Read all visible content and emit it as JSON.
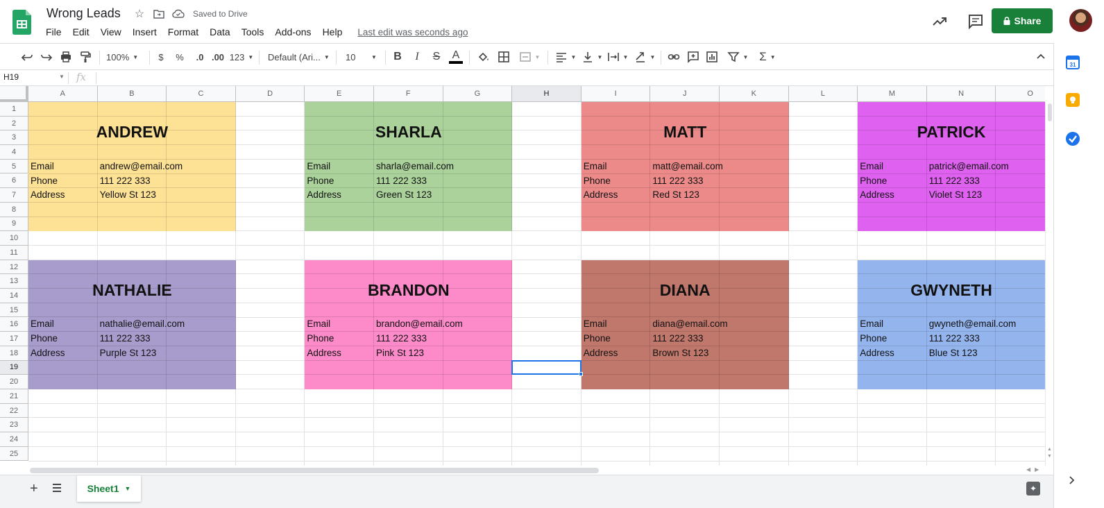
{
  "doc": {
    "title": "Wrong Leads",
    "saved_status": "Saved to Drive",
    "last_edit": "Last edit was seconds ago",
    "share_label": "Share"
  },
  "menu": [
    "File",
    "Edit",
    "View",
    "Insert",
    "Format",
    "Data",
    "Tools",
    "Add-ons",
    "Help"
  ],
  "toolbar": {
    "zoom": "100%",
    "currency": "$",
    "percent": "%",
    "decrease_decimal": ".0",
    "increase_decimal": ".00",
    "more_formats": "123",
    "font": "Default (Ari...",
    "font_size": "10"
  },
  "formula_bar": {
    "name_box": "H19",
    "fx_label": "fx",
    "content": ""
  },
  "columns": [
    "A",
    "B",
    "C",
    "D",
    "E",
    "F",
    "G",
    "H",
    "I",
    "J",
    "K",
    "L",
    "M",
    "N",
    "O"
  ],
  "rows": [
    "1",
    "2",
    "3",
    "4",
    "5",
    "6",
    "7",
    "8",
    "9",
    "10",
    "11",
    "12",
    "13",
    "14",
    "15",
    "16",
    "17",
    "18",
    "19",
    "20",
    "21",
    "22",
    "23",
    "24",
    "25"
  ],
  "selected_cell": "H19",
  "cards": [
    {
      "name": "ANDREW",
      "email": "andrew@email.com",
      "phone": "111 222 333",
      "address": "Yellow St 123",
      "color": "#fde195"
    },
    {
      "name": "SHARLA",
      "email": "sharla@email.com",
      "phone": "111 222 333",
      "address": "Green St 123",
      "color": "#acd29c"
    },
    {
      "name": "MATT",
      "email": "matt@email.com",
      "phone": "111 222 333",
      "address": "Red St 123",
      "color": "#ec8a8a"
    },
    {
      "name": "PATRICK",
      "email": "patrick@email.com",
      "phone": "111 222 333",
      "address": "Violet St 123",
      "color": "#df61f0"
    },
    {
      "name": "NATHALIE",
      "email": "nathalie@email.com",
      "phone": "111 222 333",
      "address": "Purple St 123",
      "color": "#a89ccc"
    },
    {
      "name": "BRANDON",
      "email": "brandon@email.com",
      "phone": "111 222 333",
      "address": "Pink St 123",
      "color": "#fd8ac9"
    },
    {
      "name": "DIANA",
      "email": "diana@email.com",
      "phone": "111 222 333",
      "address": "Brown St 123",
      "color": "#c0776c"
    },
    {
      "name": "GWYNETH",
      "email": "gwyneth@email.com",
      "phone": "111 222 333",
      "address": "Blue St 123",
      "color": "#93b4ec"
    }
  ],
  "field_labels": {
    "email": "Email",
    "phone": "Phone",
    "address": "Address"
  },
  "sheets": [
    {
      "name": "Sheet1",
      "active": true
    }
  ],
  "colors": {
    "accent": "#188038",
    "selection": "#1a73e8"
  }
}
